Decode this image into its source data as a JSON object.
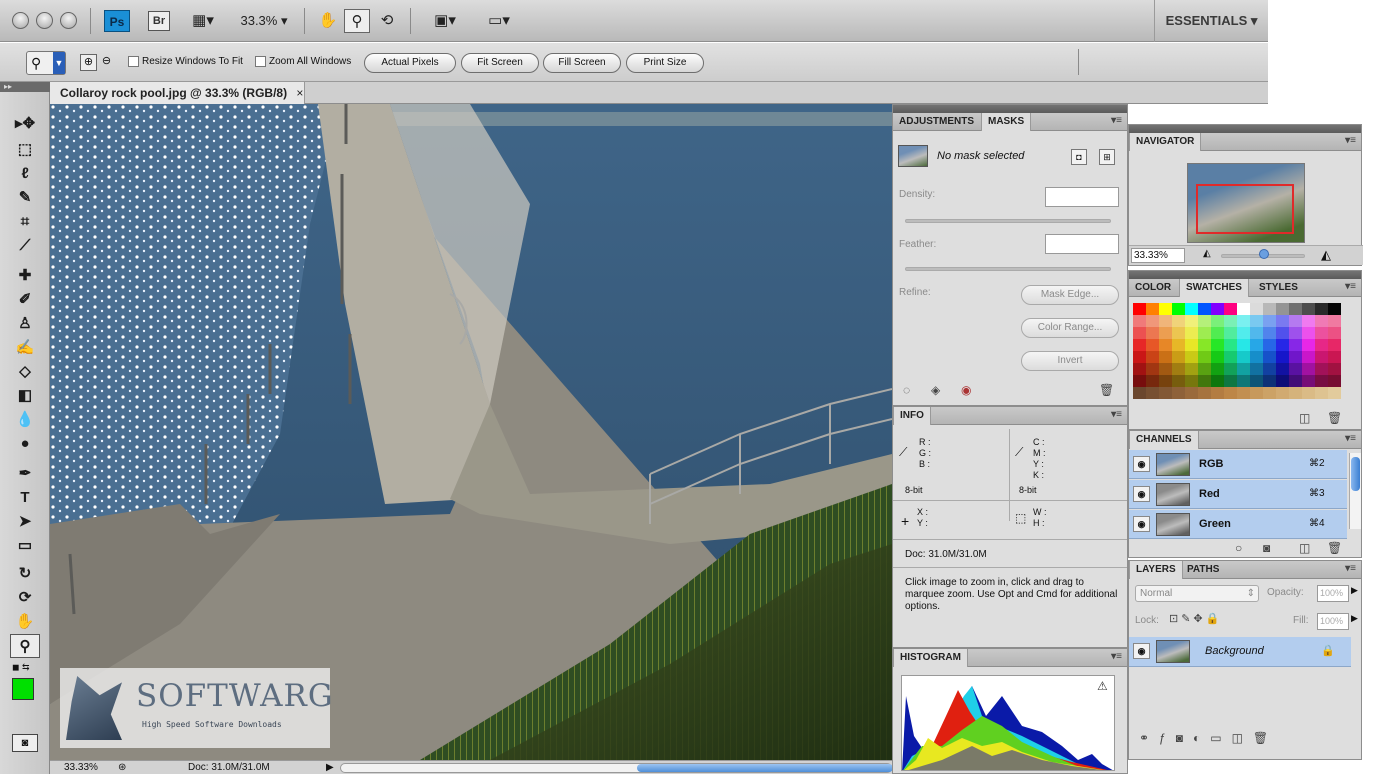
{
  "menubar": {
    "ps_logo": "Ps",
    "br_logo": "Br",
    "zoom": "33.3%",
    "dropdown_arrow": "▾",
    "workspace": "ESSENTIALS ▾"
  },
  "options": {
    "resize_windows": "Resize Windows To Fit",
    "zoom_all": "Zoom All Windows",
    "actual_pixels": "Actual Pixels",
    "fit_screen": "Fit Screen",
    "fill_screen": "Fill Screen",
    "print_size": "Print Size"
  },
  "document": {
    "tab_title": "Collaroy rock pool.jpg @ 33.3% (RGB/8)",
    "close": "×",
    "status_zoom": "33.33%",
    "status_doc": "Doc: 31.0M/31.0M",
    "status_play": "▶"
  },
  "watermark": {
    "title": "SOFTWARG",
    "subtitle": "High Speed Software Downloads"
  },
  "masks_panel": {
    "tabs": [
      "ADJUSTMENTS",
      "MASKS"
    ],
    "menu": "▾≡",
    "no_mask": "No mask selected",
    "density": "Density:",
    "feather": "Feather:",
    "refine": "Refine:",
    "mask_edge": "Mask Edge...",
    "color_range": "Color Range...",
    "invert": "Invert"
  },
  "info_panel": {
    "tab": "INFO",
    "rgb": "R :\nG :\nB :",
    "cmyk": "C :\nM :\nY :\nK :",
    "bit_left": "8-bit",
    "bit_right": "8-bit",
    "xy": "X :\nY :",
    "wh": "W :\nH :",
    "doc": "Doc: 31.0M/31.0M",
    "hint": "Click image to zoom in, click and drag to marquee zoom.  Use Opt and Cmd for additional options."
  },
  "histogram_panel": {
    "tab": "HISTOGRAM",
    "warning": "⚠"
  },
  "navigator_panel": {
    "tab": "NAVIGATOR",
    "zoom": "33.33%"
  },
  "color_panel": {
    "tabs": [
      "COLOR",
      "SWATCHES",
      "STYLES"
    ]
  },
  "channels_panel": {
    "tab": "CHANNELS",
    "channels": [
      {
        "name": "RGB",
        "shortcut": "⌘2"
      },
      {
        "name": "Red",
        "shortcut": "⌘3"
      },
      {
        "name": "Green",
        "shortcut": "⌘4"
      }
    ]
  },
  "layers_panel": {
    "tabs": [
      "LAYERS",
      "PATHS"
    ],
    "blend_mode": "Normal",
    "opacity_label": "Opacity:",
    "opacity": "100%",
    "lock_label": "Lock:",
    "fill_label": "Fill:",
    "fill": "100%",
    "layer_name": "Background"
  },
  "colors": {
    "foreground": "#00e000",
    "panel_bg": "#dedede",
    "selection": "#b3cdee",
    "ps_blue": "#1a8fd6"
  }
}
